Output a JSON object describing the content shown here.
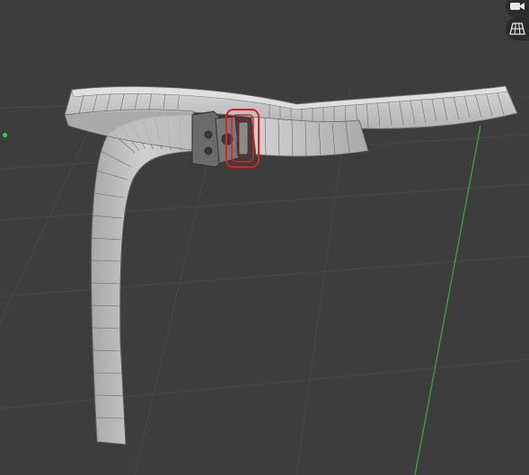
{
  "viewport": {
    "background_color": "#3d3d3d",
    "grid_line_color": "#4a4a4a",
    "y_axis_color": "#3f9b3f"
  },
  "object": {
    "mesh_color": "#c9c9c9",
    "wire_color": "#555555",
    "selection_color": "#e02020",
    "buckle_color": "#6e6e6e"
  },
  "overlays": {
    "camera_toggle_icon": "camera-icon",
    "grid_toggle_icon": "grid-icon",
    "origin_marker_color": "#3fd43f"
  }
}
